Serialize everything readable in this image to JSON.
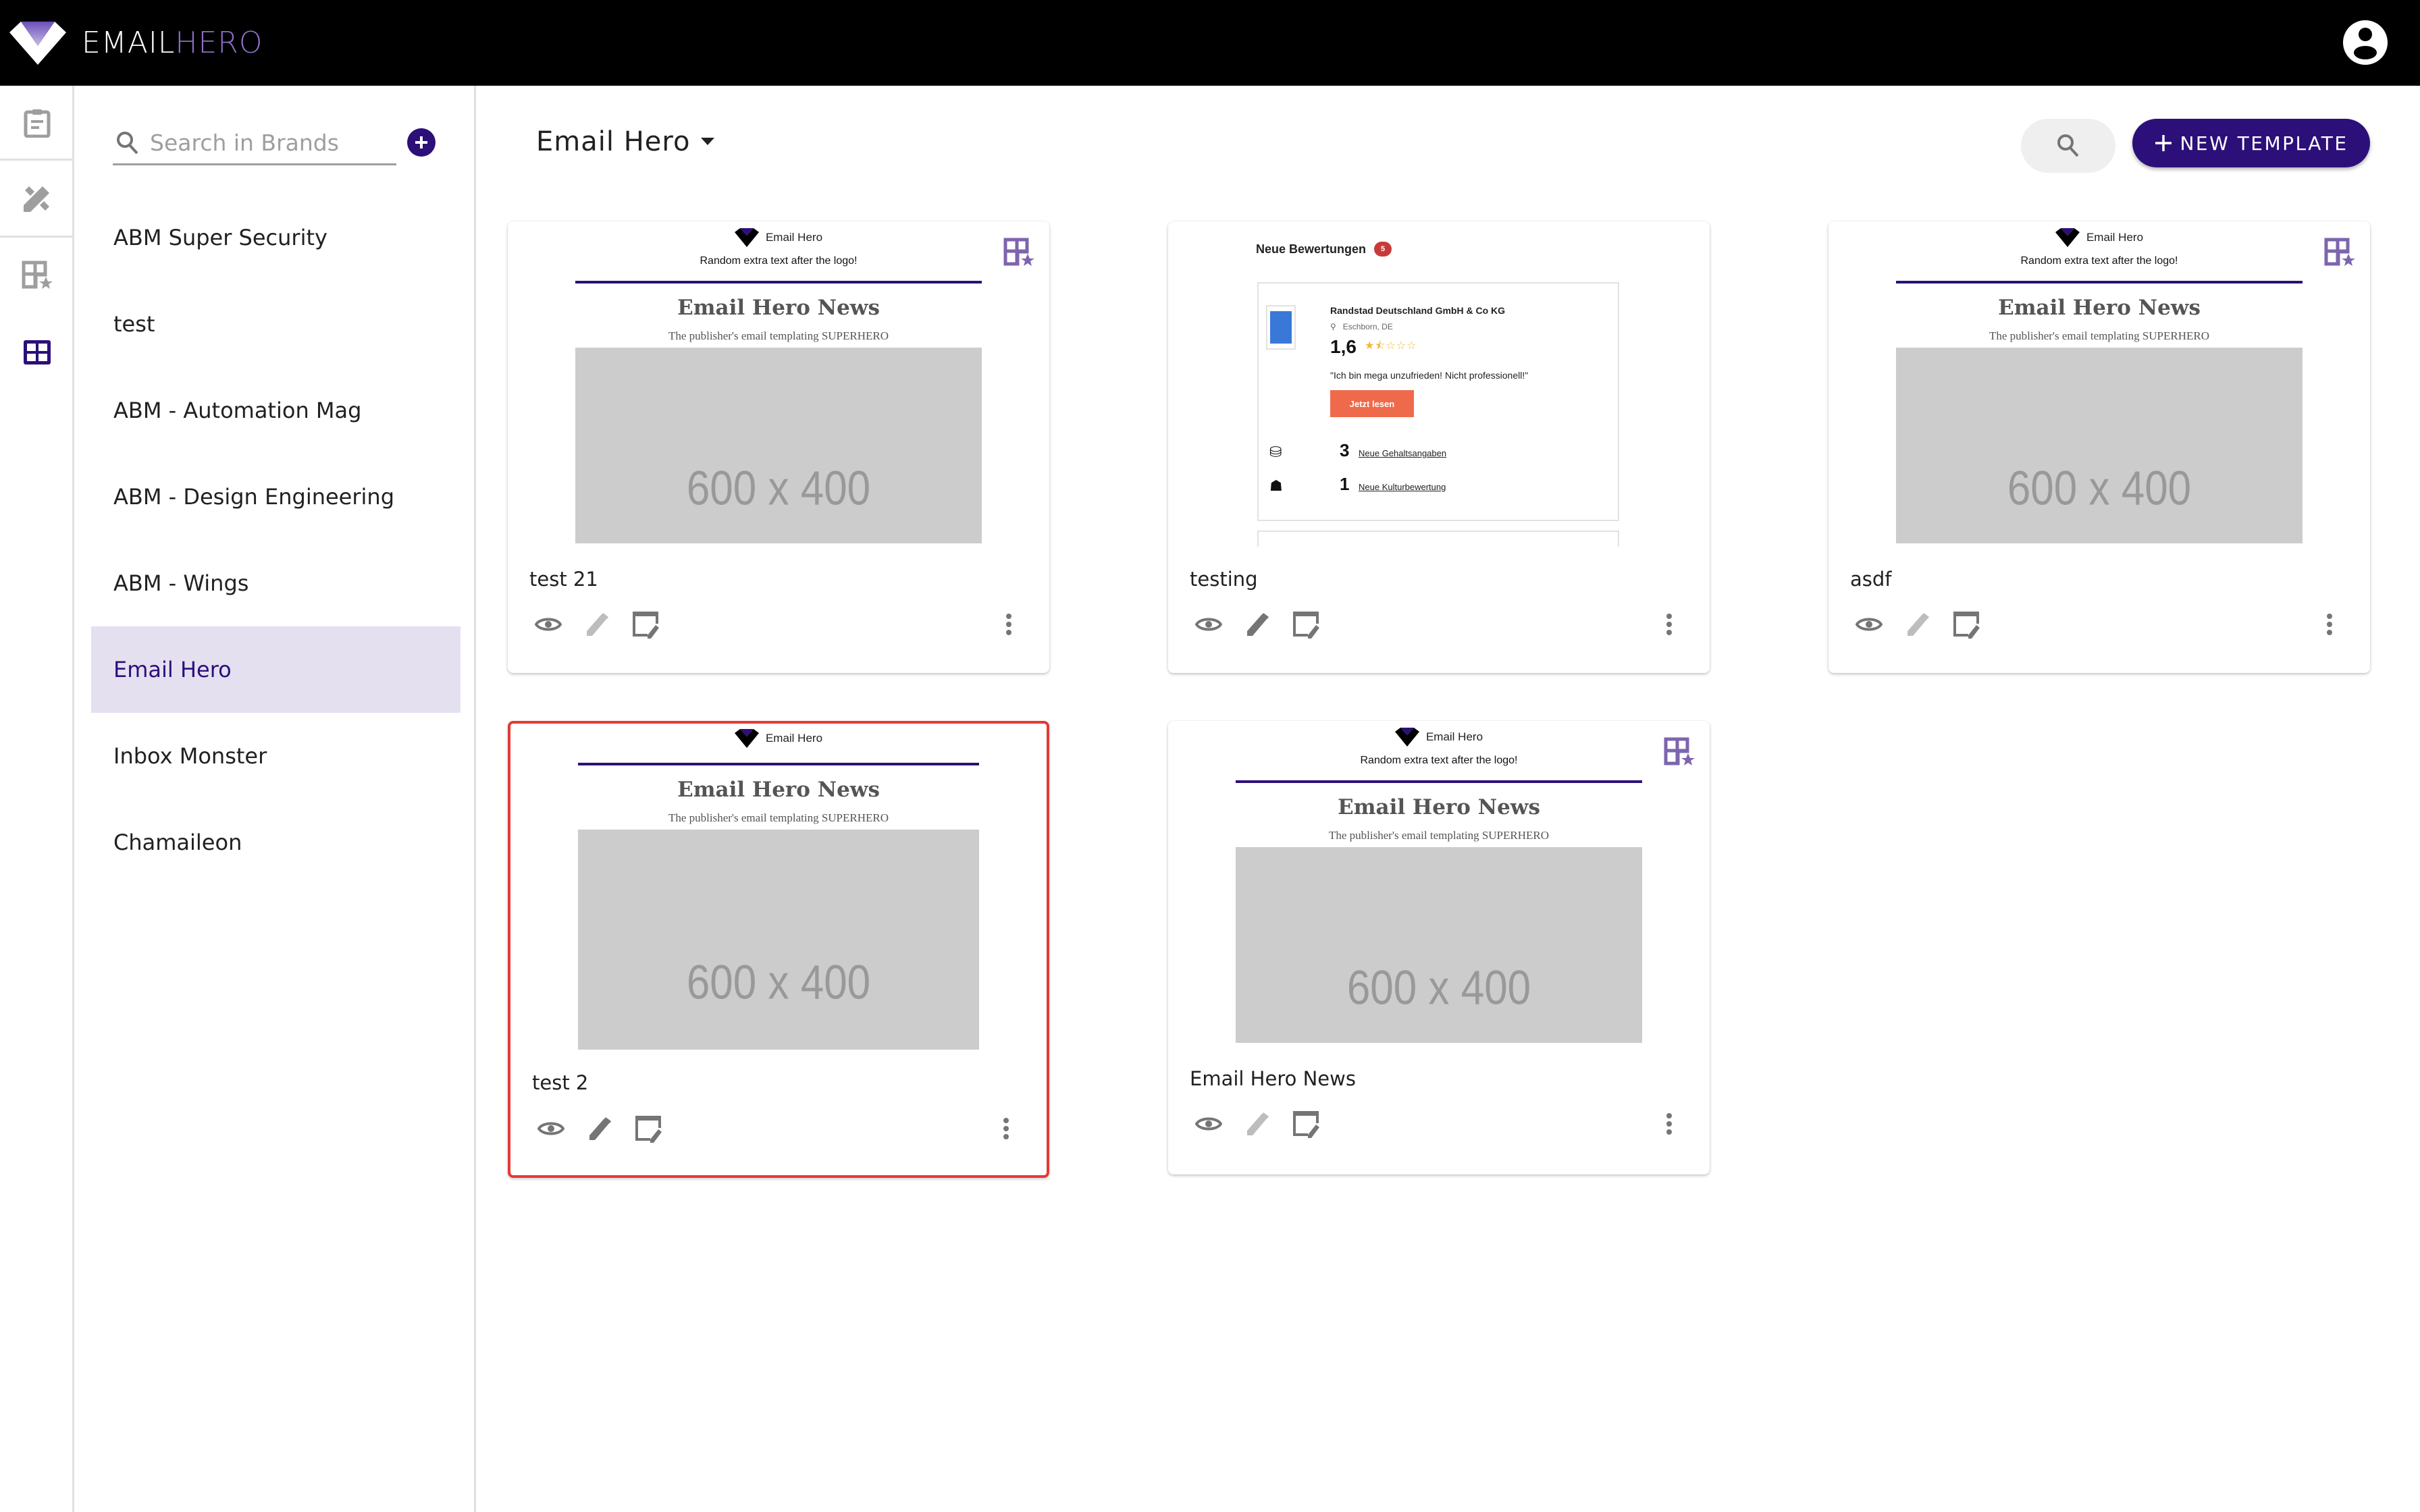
{
  "app": {
    "logo_text_primary": "EMAIL",
    "logo_text_accent": "HERO",
    "colors": {
      "primary": "#2c0f79",
      "accent_logo": "#8a6fc4",
      "selected_border": "#e53935",
      "active_brand_bg": "#e4e0f0",
      "cta_orange": "#ef6a4a"
    }
  },
  "topbar": {
    "user_icon": "account-circle-icon"
  },
  "rail": {
    "items": [
      {
        "name": "clipboard",
        "icon": "clipboard-icon",
        "active": false
      },
      {
        "name": "design-tools",
        "icon": "design-tools-icon",
        "active": false
      },
      {
        "name": "favorite-templates",
        "icon": "table-star-icon",
        "active": false
      },
      {
        "name": "templates",
        "icon": "grid-icon",
        "active": true
      }
    ]
  },
  "brands": {
    "search_placeholder": "Search in Brands",
    "search_value": "",
    "add_icon": "plus-circle-icon",
    "items": [
      {
        "label": "ABM Super Security",
        "active": false
      },
      {
        "label": "test",
        "active": false
      },
      {
        "label": "ABM - Automation Mag",
        "active": false
      },
      {
        "label": "ABM - Design Engineering",
        "active": false
      },
      {
        "label": "ABM - Wings",
        "active": false
      },
      {
        "label": "Email Hero",
        "active": true
      },
      {
        "label": "Inbox Monster",
        "active": false
      },
      {
        "label": "Chamaileon",
        "active": false
      }
    ]
  },
  "main": {
    "brand_selector": "Email Hero",
    "search_icon": "search-icon",
    "new_template_label": "NEW TEMPLATE",
    "email_preview": {
      "logo_label": "Email Hero",
      "subline": "Random extra text after the logo!",
      "title": "Email Hero News",
      "tagline": "The publisher's email templating SUPERHERO",
      "image_placeholder": "600 x 400"
    },
    "review_preview": {
      "heading": "Neue Bewertungen",
      "badge": "5",
      "company": "Randstad Deutschland GmbH & Co KG",
      "location": "Eschborn, DE",
      "score": "1,6",
      "stars": "★⯪☆☆☆",
      "quote": "\"Ich bin mega unzufrieden! Nicht professionell!\"",
      "button": "Jetzt lesen",
      "stats": [
        {
          "count": "3",
          "label": "Neue Gehaltsangaben",
          "icon": "coins-icon"
        },
        {
          "count": "1",
          "label": "Neue Kulturbewertung",
          "icon": "people-icon"
        }
      ]
    },
    "templates": [
      {
        "title": "test 21",
        "type": "email",
        "show_subline": true,
        "favorite": true,
        "edit_enabled": false,
        "selected": false
      },
      {
        "title": "testing",
        "type": "review",
        "show_subline": false,
        "favorite": false,
        "edit_enabled": true,
        "selected": false
      },
      {
        "title": "asdf",
        "type": "email",
        "show_subline": true,
        "favorite": true,
        "edit_enabled": false,
        "selected": false
      },
      {
        "title": "test 2",
        "type": "email",
        "show_subline": false,
        "favorite": false,
        "edit_enabled": true,
        "selected": true
      },
      {
        "title": "Email Hero News",
        "type": "email",
        "show_subline": true,
        "favorite": true,
        "edit_enabled": false,
        "selected": false
      }
    ]
  }
}
